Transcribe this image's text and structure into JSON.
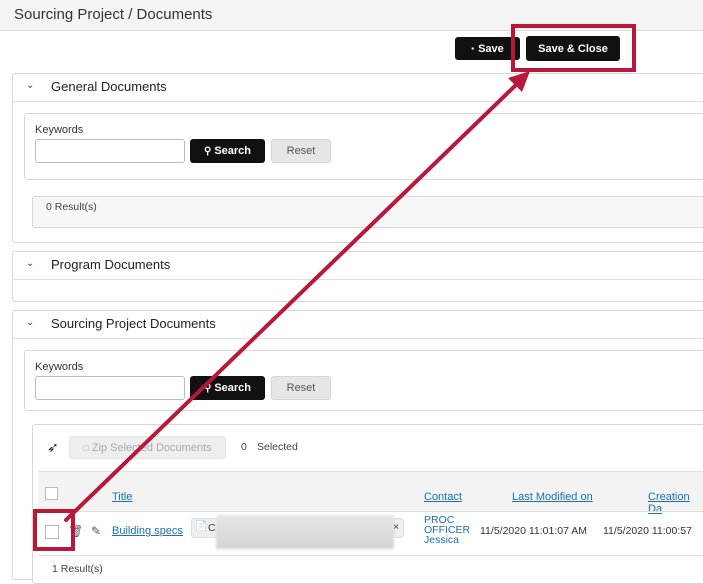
{
  "page": {
    "title": "Sourcing Project / Documents"
  },
  "toolbar": {
    "save_label": "Save",
    "save_close_label": "Save & Close"
  },
  "general": {
    "header": "General Documents",
    "keywords_label": "Keywords",
    "search_label": "Search",
    "reset_label": "Reset",
    "results": "0 Result(s)"
  },
  "program": {
    "header": "Program Documents"
  },
  "sourcing": {
    "header": "Sourcing Project Documents",
    "keywords_label": "Keywords",
    "search_label": "Search",
    "reset_label": "Reset",
    "zip_label": "Zip Selected Documents",
    "selected_count": "0",
    "selected_label": "Selected",
    "columns": {
      "title": "Title",
      "contact": "Contact",
      "last_modified": "Last Modified on",
      "creation": "Creation Da"
    },
    "row": {
      "title": "Building specs",
      "file_chip": "C",
      "chip_close": "×",
      "contact_line1": "PROC",
      "contact_line2": "OFFICER",
      "contact_line3": "Jessica",
      "last_modified": "11/5/2020 11:01:07 AM",
      "creation": "11/5/2020 11:00:57"
    },
    "results": "1 Result(s)"
  },
  "accent_color": "#b8193b"
}
